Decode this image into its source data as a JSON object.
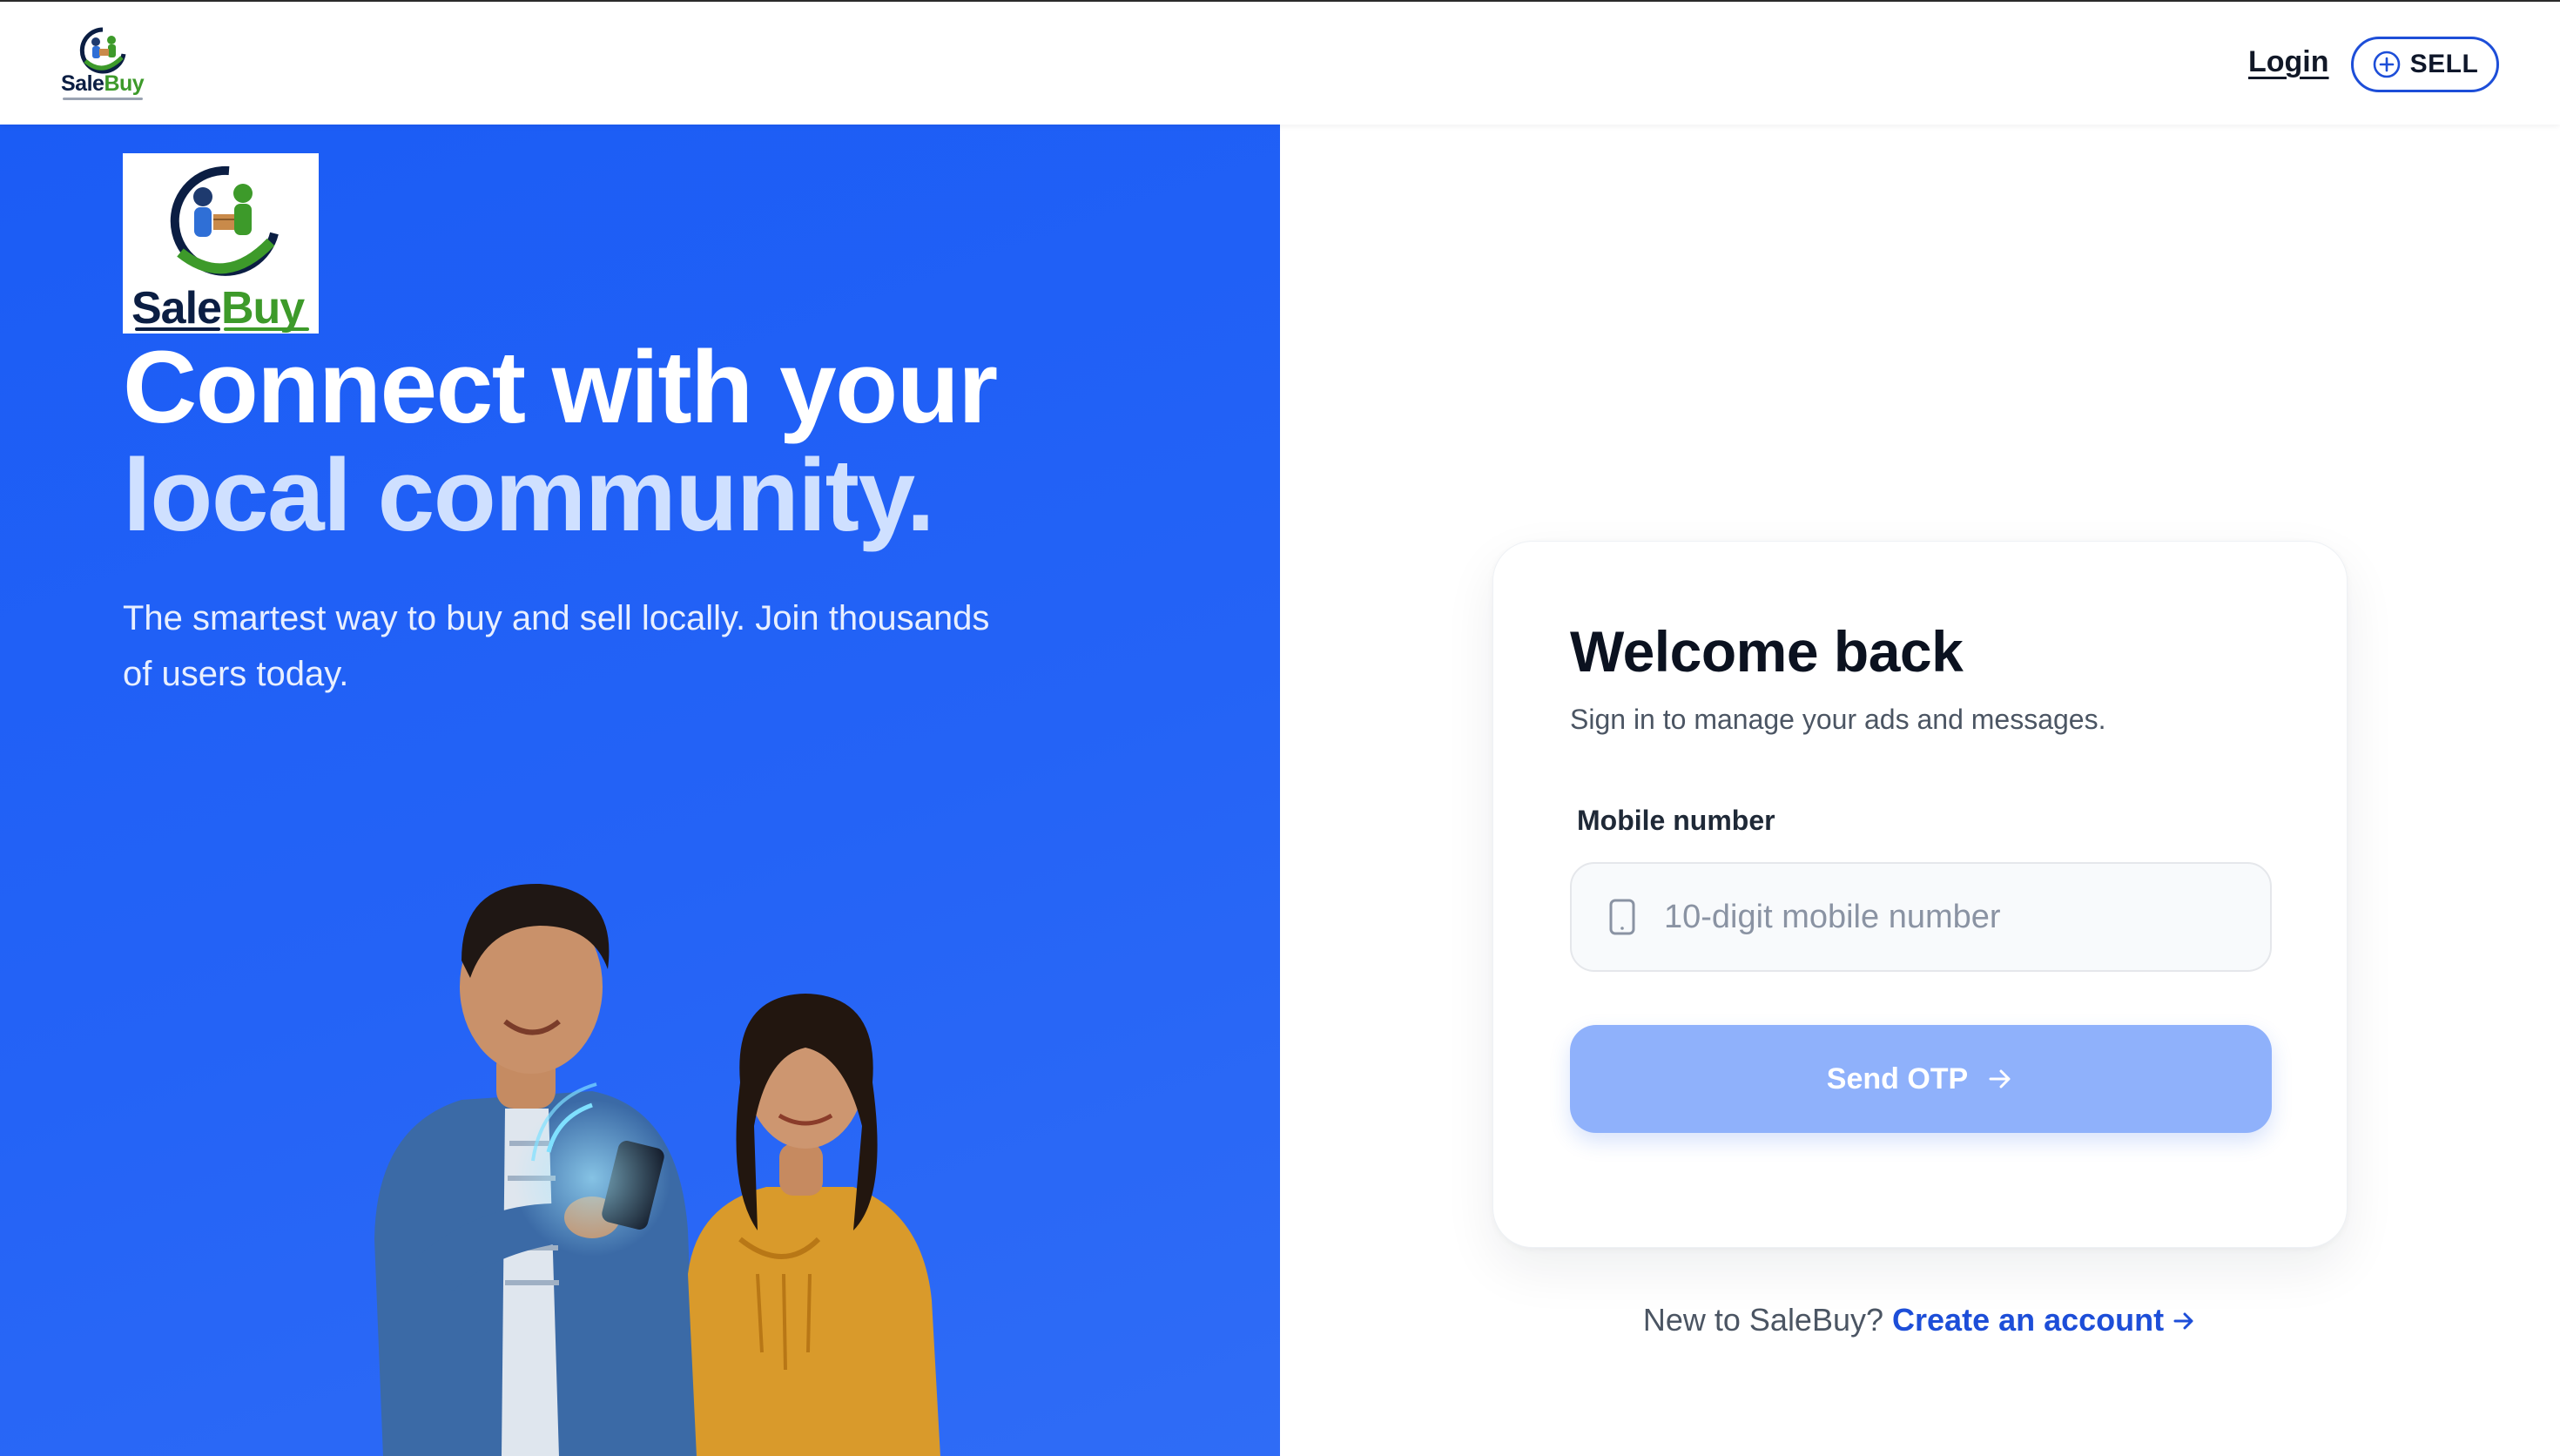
{
  "brand": {
    "sale": "Sale",
    "buy": "Buy",
    "colors": {
      "navy": "#0b1e43",
      "green": "#3d9a2a"
    }
  },
  "nav": {
    "login_label": "Login",
    "sell_label": "SELL",
    "sell_icon": "plus-circle-icon"
  },
  "hero": {
    "title_line1": "Connect with your",
    "title_line2": "local community.",
    "subtitle": "The smartest way to buy and sell locally. Join thousands of users today.",
    "background": "#1b5cf5"
  },
  "login_card": {
    "title": "Welcome back",
    "subtitle": "Sign in to manage your ads and messages.",
    "mobile_label": "Mobile number",
    "mobile_value": "",
    "mobile_placeholder": "10-digit mobile number",
    "mobile_icon": "phone-icon",
    "send_otp_label": "Send OTP",
    "send_otp_icon": "arrow-right-icon",
    "button_color": "#8fb1fb"
  },
  "signup": {
    "prompt": "New to SaleBuy?",
    "link_label": "Create an account",
    "link_icon": "arrow-right-icon",
    "link_color": "#1d4ed8"
  }
}
